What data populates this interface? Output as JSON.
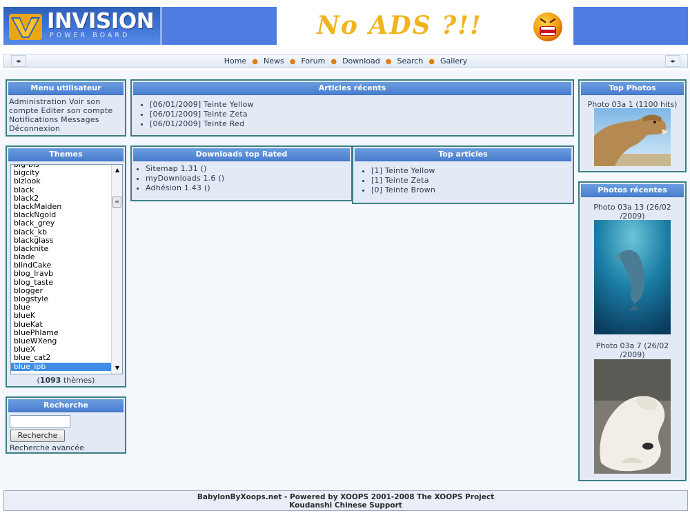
{
  "header": {
    "logo_title": "INVISION",
    "logo_subtitle": "POWER BOARD",
    "ad_text": "No ADS ?!!"
  },
  "nav": {
    "left_arrow": "◂▸",
    "right_arrow": "◂▸",
    "links": [
      "Home",
      "News",
      "Forum",
      "Download",
      "Search",
      "Gallery"
    ]
  },
  "menu": {
    "title": "Menu utilisateur",
    "text": "Administration Voir son compte Editer son compte Notifications Messages Déconnexion"
  },
  "themes": {
    "title": "Themes",
    "items": [
      "big-bis",
      "bigcity",
      "bizlook",
      "black",
      "black2",
      "blackMaiden",
      "blackNgold",
      "black_grey",
      "black_kb",
      "blackglass",
      "blacknite",
      "blade",
      "blindCake",
      "blog_lravb",
      "blog_taste",
      "blogger",
      "blogstyle",
      "blue",
      "blueK",
      "blueKat",
      "bluePhlame",
      "blueWXeng",
      "blueX",
      "blue_cat2",
      "blue_ipb"
    ],
    "selected": "blue_ipb",
    "count_open": "(",
    "count": "1093",
    "count_suffix": " thèmes)"
  },
  "search": {
    "title": "Recherche",
    "input_value": "",
    "button": "Recherche",
    "advanced": "Recherche avancée"
  },
  "articles": {
    "title": "Articles récents",
    "items": [
      "[06/01/2009] Teinte Yellow",
      "[06/01/2009] Teinte Zeta",
      "[06/01/2009] Teinte Red"
    ]
  },
  "downloads": {
    "title": "Downloads top Rated",
    "items": [
      "Sitemap 1.31 ()",
      "myDownloads 1.6 ()",
      "Adhésion 1.43 ()"
    ]
  },
  "top_articles": {
    "title": "Top articles",
    "items": [
      "[1] Teinte Yellow",
      "[1] Teinte Zeta",
      "[0] Teinte Brown"
    ]
  },
  "top_photos": {
    "title": "Top Photos",
    "caption": "Photo 03a 1 (1100 hits)"
  },
  "recent_photos": {
    "title": "Photos récentes",
    "items": [
      {
        "caption_1": "Photo 03a 13 (26/02",
        "caption_2": "/2009)"
      },
      {
        "caption_1": "Photo 03a 7 (26/02",
        "caption_2": "/2009)"
      }
    ]
  },
  "footer": {
    "line1": "BabylonByXoops.net - Powered by XOOPS 2001-2008 The XOOPS Project",
    "line2": "Koudanshi Chinese Support"
  }
}
